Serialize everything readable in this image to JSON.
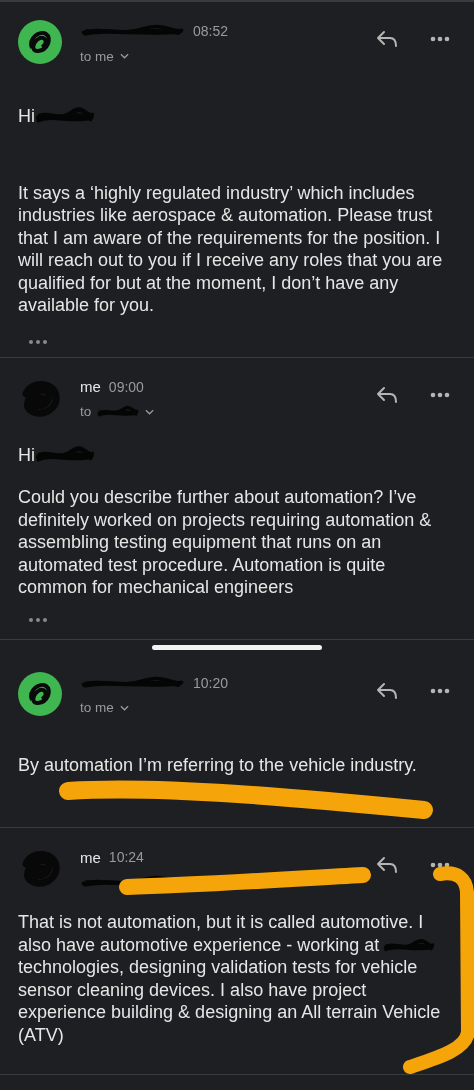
{
  "messages": [
    {
      "kind": "received",
      "time": "08:52",
      "recipient": [
        {
          "kind": "text",
          "text": "to me"
        }
      ],
      "expandable": true,
      "greeting": [
        {
          "kind": "text",
          "text": "Hi"
        },
        {
          "kind": "redacted"
        }
      ],
      "body": [
        {
          "kind": "text",
          "text": "It says a ‘highly regulated industry’ which includes industries like aerospace & automation. Please trust that I am aware of the requirements for the position. I will reach out to you if I receive any roles that you are qualified for but at the moment, I don’t have any available for you."
        }
      ],
      "quoted": true
    },
    {
      "kind": "sent",
      "sender": "me",
      "time": "09:00",
      "recipient": [
        {
          "kind": "text",
          "text": "to"
        },
        {
          "kind": "redacted"
        }
      ],
      "expandable": true,
      "greeting": [
        {
          "kind": "text",
          "text": "Hi"
        },
        {
          "kind": "redacted"
        }
      ],
      "body": [
        {
          "kind": "text",
          "text": "Could you describe further about automation? I’ve definitely worked on projects requiring automation & assembling testing equipment that runs on an automated test procedure. Automation is quite common for mechanical engineers"
        }
      ],
      "quoted": true
    },
    {
      "kind": "received",
      "time": "10:20",
      "recipient": [
        {
          "kind": "text",
          "text": "to me"
        }
      ],
      "expandable": true,
      "body": [
        {
          "kind": "text",
          "text": "By automation I’m referring to the vehicle industry."
        }
      ],
      "quoted": false
    },
    {
      "kind": "sent",
      "sender": "me",
      "time": "10:24",
      "recipient": [
        {
          "kind": "redacted"
        }
      ],
      "expandable": false,
      "body": [
        {
          "kind": "text",
          "text": "That is not automation, but it is called automotive. I"
        },
        {
          "kind": "text",
          "text": "also have automotive experience - working at"
        },
        {
          "kind": "redacted"
        },
        {
          "kind": "text",
          "text": "technologies, designing validation tests for vehicle sensor cleaning devices. I also have project experience building & designing an All terrain Vehicle (ATV)"
        }
      ],
      "quoted": false
    }
  ]
}
